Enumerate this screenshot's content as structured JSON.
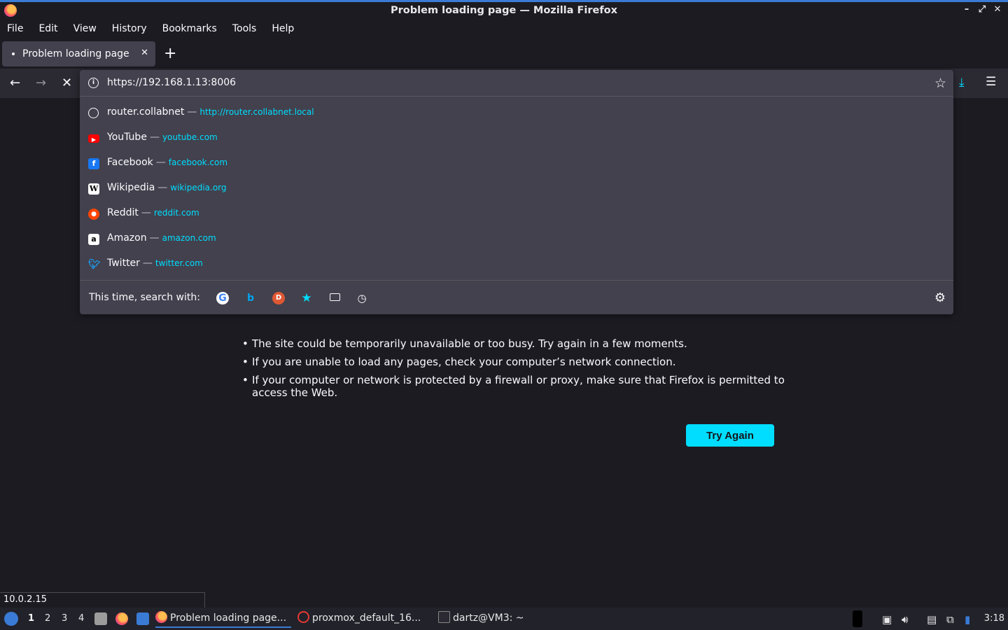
{
  "window": {
    "title": "Problem loading page — Mozilla Firefox"
  },
  "menu": [
    "File",
    "Edit",
    "View",
    "History",
    "Bookmarks",
    "Tools",
    "Help"
  ],
  "tab": {
    "label": "Problem loading page"
  },
  "urlbar": {
    "value": "https://192.168.1.13:8006"
  },
  "suggestions": [
    {
      "name": "router.collabnet",
      "url": "http://router.collabnet.local",
      "icon": "globe-icon",
      "color": "#fbfbfe"
    },
    {
      "name": "YouTube",
      "url": "youtube.com",
      "icon": "youtube-icon",
      "color": "#ff0000"
    },
    {
      "name": "Facebook",
      "url": "facebook.com",
      "icon": "facebook-icon",
      "color": "#1877f2"
    },
    {
      "name": "Wikipedia",
      "url": "wikipedia.org",
      "icon": "wikipedia-icon",
      "color": "#ffffff"
    },
    {
      "name": "Reddit",
      "url": "reddit.com",
      "icon": "reddit-icon",
      "color": "#ff4500"
    },
    {
      "name": "Amazon",
      "url": "amazon.com",
      "icon": "amazon-icon",
      "color": "#ffffff"
    },
    {
      "name": "Twitter",
      "url": "twitter.com",
      "icon": "twitter-icon",
      "color": "#1d9bf0"
    }
  ],
  "search": {
    "label": "This time, search with:",
    "engines": [
      "google-icon",
      "bing-icon",
      "duckduckgo-icon",
      "bookmarks-icon",
      "tabs-icon",
      "history-icon"
    ]
  },
  "error": {
    "items": [
      "The site could be temporarily unavailable or too busy. Try again in a few moments.",
      "If you are unable to load any pages, check your computer’s network connection.",
      "If your computer or network is protected by a firewall or proxy, make sure that Firefox is permitted to access the Web."
    ],
    "button": "Try Again"
  },
  "status": {
    "text": "10.0.2.15"
  },
  "taskbar": {
    "workspaces": [
      "1",
      "2",
      "3",
      "4"
    ],
    "tasks": [
      "Problem loading page...",
      "proxmox_default_16...",
      "dartz@VM3: ~"
    ],
    "clock": "3:18"
  },
  "colors": {
    "accent": "#00ddff",
    "panel": "#42414d",
    "toolbar": "#2b2a33"
  }
}
